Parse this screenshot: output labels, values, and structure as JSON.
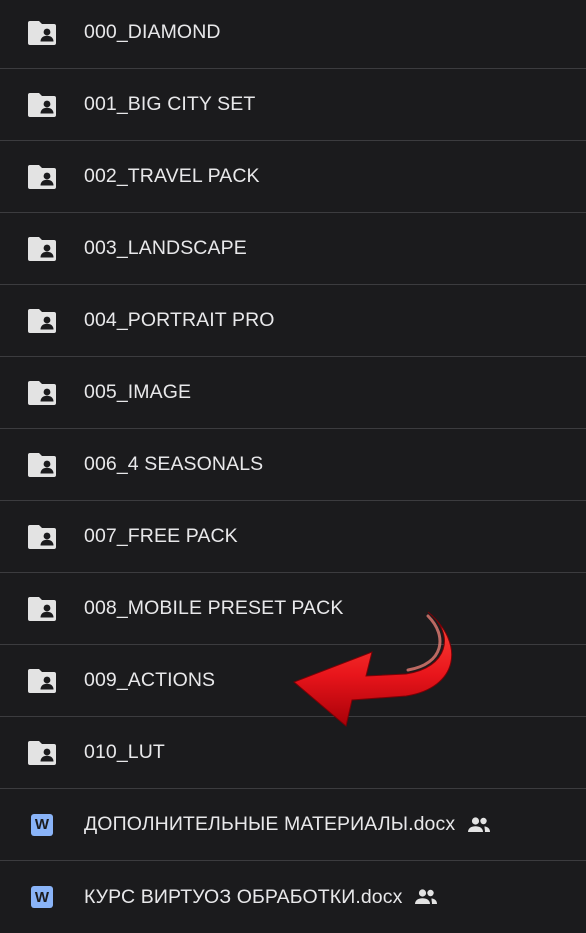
{
  "file_list": {
    "items": [
      {
        "name": "000_DIAMOND",
        "type": "shared-folder",
        "icon": "shared-folder-icon"
      },
      {
        "name": "001_BIG CITY SET",
        "type": "shared-folder",
        "icon": "shared-folder-icon"
      },
      {
        "name": "002_TRAVEL PACK",
        "type": "shared-folder",
        "icon": "shared-folder-icon"
      },
      {
        "name": "003_LANDSCAPE",
        "type": "shared-folder",
        "icon": "shared-folder-icon"
      },
      {
        "name": "004_PORTRAIT PRO",
        "type": "shared-folder",
        "icon": "shared-folder-icon"
      },
      {
        "name": "005_IMAGE",
        "type": "shared-folder",
        "icon": "shared-folder-icon"
      },
      {
        "name": "006_4 SEASONALS",
        "type": "shared-folder",
        "icon": "shared-folder-icon"
      },
      {
        "name": "007_FREE PACK",
        "type": "shared-folder",
        "icon": "shared-folder-icon"
      },
      {
        "name": "008_MOBILE PRESET PACK",
        "type": "shared-folder",
        "icon": "shared-folder-icon"
      },
      {
        "name": "009_ACTIONS",
        "type": "shared-folder",
        "icon": "shared-folder-icon"
      },
      {
        "name": "010_LUT",
        "type": "shared-folder",
        "icon": "shared-folder-icon"
      },
      {
        "name": "ДОПОЛНИТЕЛЬНЫЕ МАТЕРИАЛЫ.docx",
        "type": "word-document",
        "icon": "word-document-icon",
        "badge_letter": "W",
        "shared": true,
        "shared_icon": "people-icon"
      },
      {
        "name": "КУРС ВИРТУОЗ ОБРАБОТКИ.docx",
        "type": "word-document",
        "icon": "word-document-icon",
        "badge_letter": "W",
        "shared": true,
        "shared_icon": "people-icon"
      }
    ]
  },
  "annotation": {
    "icon": "red-curved-arrow-icon",
    "points_to": "009_ACTIONS",
    "color": "#e8151b"
  },
  "colors": {
    "background": "#1b1b1d",
    "text": "#e8e8ea",
    "divider": "#3c3c3f",
    "folder_icon": "#e3e3e3",
    "word_badge": "#8ab4f8"
  }
}
